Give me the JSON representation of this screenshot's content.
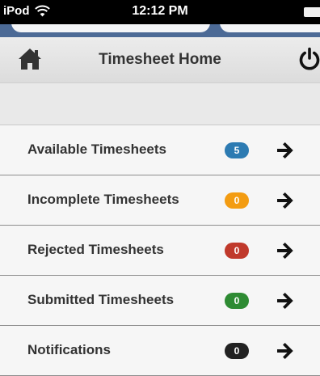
{
  "status_bar": {
    "carrier": "iPod",
    "time": "12:12 PM"
  },
  "header": {
    "title": "Timesheet Home",
    "home_icon": "home-icon",
    "power_icon": "power-icon"
  },
  "items": [
    {
      "label": "Available Timesheets",
      "count": "5",
      "badge_color": "#2d7bb2"
    },
    {
      "label": "Incomplete Timesheets",
      "count": "0",
      "badge_color": "#f39c12"
    },
    {
      "label": "Rejected Timesheets",
      "count": "0",
      "badge_color": "#c0392b"
    },
    {
      "label": "Submitted Timesheets",
      "count": "0",
      "badge_color": "#2e8b33"
    },
    {
      "label": "Notifications",
      "count": "0",
      "badge_color": "#222222"
    }
  ],
  "colors": {
    "accent_blue": "#4c6a96",
    "header_bg": "#e4e4e4",
    "text": "#333333"
  }
}
